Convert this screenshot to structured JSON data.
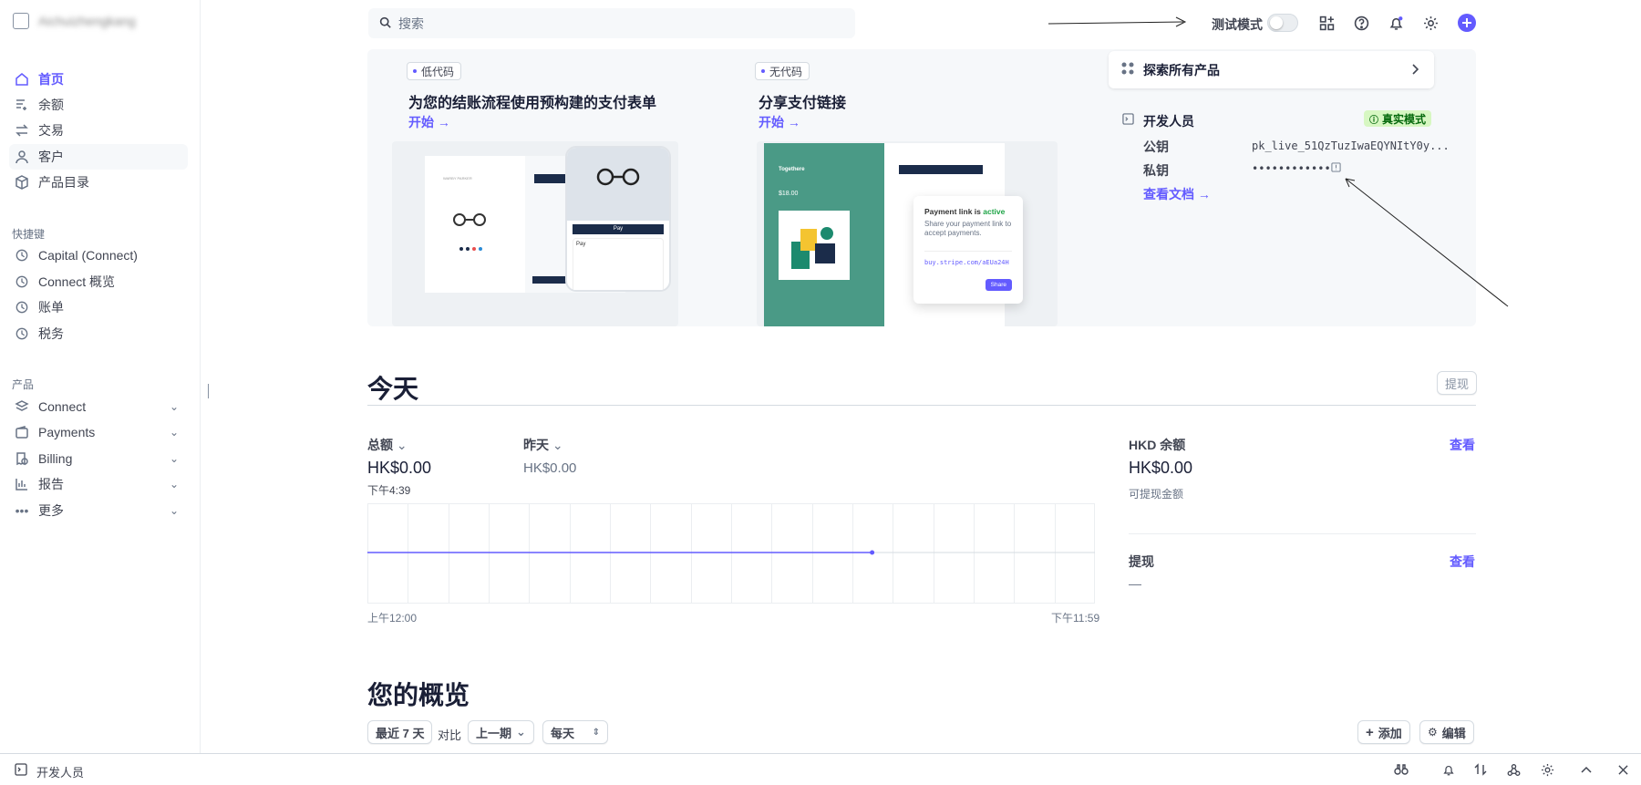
{
  "account": {
    "name": "Aichuizhengkang"
  },
  "sidebar": {
    "main_items": [
      {
        "label": "首页",
        "icon": "home-icon"
      },
      {
        "label": "余额",
        "icon": "balance-icon"
      },
      {
        "label": "交易",
        "icon": "transfer-icon"
      },
      {
        "label": "客户",
        "icon": "person-icon"
      },
      {
        "label": "产品目录",
        "icon": "box-icon"
      }
    ],
    "shortcuts_label": "快捷键",
    "shortcuts": [
      {
        "label": "Capital (Connect)"
      },
      {
        "label": "Connect 概览"
      },
      {
        "label": "账单"
      },
      {
        "label": "税务"
      }
    ],
    "products_label": "产品",
    "products": [
      {
        "label": "Connect"
      },
      {
        "label": "Payments"
      },
      {
        "label": "Billing"
      },
      {
        "label": "报告"
      },
      {
        "label": "更多"
      }
    ]
  },
  "topbar": {
    "search_placeholder": "搜索",
    "test_mode_label": "测试模式"
  },
  "banner": {
    "card1": {
      "badge": "低代码",
      "title": "为您的结账流程使用预构建的支付表单",
      "link": "开始 →"
    },
    "card2": {
      "badge": "无代码",
      "title": "分享支付链接",
      "link": "开始 →",
      "mock": {
        "brand": "Togethere",
        "price": "$18.00",
        "status_prefix": "Payment link is ",
        "status_word": "active",
        "desc": "Share your payment link to accept payments.",
        "url": "buy.stripe.com/aEUa24H",
        "share": "Share"
      }
    },
    "card1_mock": {
      "brand": "WARBY PARKER",
      "pay": " Pay",
      "pay_top": " Pay"
    },
    "explore_label": "探索所有产品",
    "developer": {
      "title": "开发人员",
      "live_badge": "真实模式",
      "public_key_label": "公钥",
      "public_key_value": "pk_live_51QzTuzIwaEQYNItY0y...",
      "secret_key_label": "私钥",
      "secret_key_value": "••••••••••••",
      "docs_link": "查看文档 →"
    }
  },
  "today": {
    "heading": "今天",
    "payout_button": "提现",
    "gross_label": "总额",
    "gross_value": "HK$0.00",
    "gross_time": "下午4:39",
    "yesterday_label": "昨天",
    "yesterday_value": "HK$0.00",
    "axis_start": "上午12:00",
    "axis_end": "下午11:59",
    "balance_label": "HKD 余额",
    "balance_link": "查看",
    "balance_value": "HK$0.00",
    "balance_sub": "可提现金额",
    "payouts_label": "提现",
    "payouts_link": "查看",
    "payouts_value": "—"
  },
  "chart_data": {
    "type": "line",
    "x": [
      "上午12:00",
      "下午4:39"
    ],
    "series": [
      {
        "values": [
          0,
          0
        ]
      }
    ],
    "xlabel": "",
    "ylabel": "",
    "grid": true
  },
  "overview": {
    "heading": "您的概览",
    "range_button": "最近 7 天",
    "compare_label": "对比",
    "compare_button": "上一期",
    "interval_button": "每天",
    "add_button": "添加",
    "edit_button": "编辑"
  },
  "bottombar": {
    "label": "开发人员"
  },
  "colors": {
    "accent": "#635bff",
    "live_badge_bg": "#d7f7c2",
    "payment_card_green": "#4a9a86"
  }
}
